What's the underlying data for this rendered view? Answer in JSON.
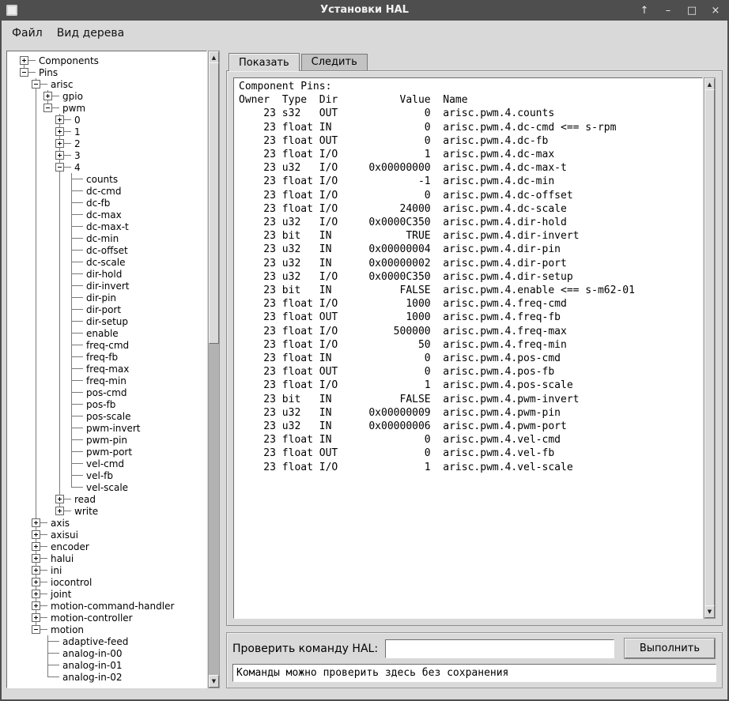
{
  "window": {
    "title": "Установки HAL",
    "controls": [
      {
        "name": "shade",
        "glyph": "↑"
      },
      {
        "name": "minimize",
        "glyph": "–"
      },
      {
        "name": "maximize",
        "glyph": "□"
      },
      {
        "name": "close",
        "glyph": "×"
      }
    ]
  },
  "menu": {
    "items": [
      {
        "label": "Файл"
      },
      {
        "label": "Вид дерева"
      }
    ]
  },
  "tabs": [
    {
      "label": "Показать",
      "active": true
    },
    {
      "label": "Следить",
      "active": false
    }
  ],
  "icons": {
    "scroll_up": "▲",
    "scroll_down": "▼"
  },
  "tree": {
    "nodes": [
      {
        "label": "Components",
        "state": "collapsed"
      },
      {
        "label": "Pins",
        "state": "expanded",
        "children": [
          {
            "label": "arisc",
            "state": "expanded",
            "children": [
              {
                "label": "gpio",
                "state": "collapsed"
              },
              {
                "label": "pwm",
                "state": "expanded",
                "children": [
                  {
                    "label": "0",
                    "state": "collapsed"
                  },
                  {
                    "label": "1",
                    "state": "collapsed"
                  },
                  {
                    "label": "2",
                    "state": "collapsed"
                  },
                  {
                    "label": "3",
                    "state": "collapsed"
                  },
                  {
                    "label": "4",
                    "state": "expanded",
                    "children": [
                      {
                        "label": "counts"
                      },
                      {
                        "label": "dc-cmd"
                      },
                      {
                        "label": "dc-fb"
                      },
                      {
                        "label": "dc-max"
                      },
                      {
                        "label": "dc-max-t"
                      },
                      {
                        "label": "dc-min"
                      },
                      {
                        "label": "dc-offset"
                      },
                      {
                        "label": "dc-scale"
                      },
                      {
                        "label": "dir-hold"
                      },
                      {
                        "label": "dir-invert"
                      },
                      {
                        "label": "dir-pin"
                      },
                      {
                        "label": "dir-port"
                      },
                      {
                        "label": "dir-setup"
                      },
                      {
                        "label": "enable"
                      },
                      {
                        "label": "freq-cmd"
                      },
                      {
                        "label": "freq-fb"
                      },
                      {
                        "label": "freq-max"
                      },
                      {
                        "label": "freq-min"
                      },
                      {
                        "label": "pos-cmd"
                      },
                      {
                        "label": "pos-fb"
                      },
                      {
                        "label": "pos-scale"
                      },
                      {
                        "label": "pwm-invert"
                      },
                      {
                        "label": "pwm-pin"
                      },
                      {
                        "label": "pwm-port"
                      },
                      {
                        "label": "vel-cmd"
                      },
                      {
                        "label": "vel-fb"
                      },
                      {
                        "label": "vel-scale"
                      }
                    ]
                  },
                  {
                    "label": "read",
                    "state": "collapsed"
                  },
                  {
                    "label": "write",
                    "state": "collapsed"
                  }
                ]
              }
            ]
          },
          {
            "label": "axis",
            "state": "collapsed"
          },
          {
            "label": "axisui",
            "state": "collapsed"
          },
          {
            "label": "encoder",
            "state": "collapsed"
          },
          {
            "label": "halui",
            "state": "collapsed"
          },
          {
            "label": "ini",
            "state": "collapsed"
          },
          {
            "label": "iocontrol",
            "state": "collapsed"
          },
          {
            "label": "joint",
            "state": "collapsed"
          },
          {
            "label": "motion-command-handler",
            "state": "collapsed"
          },
          {
            "label": "motion-controller",
            "state": "collapsed"
          },
          {
            "label": "motion",
            "state": "expanded",
            "children": [
              {
                "label": "adaptive-feed"
              },
              {
                "label": "analog-in-00"
              },
              {
                "label": "analog-in-01"
              },
              {
                "label": "analog-in-02"
              }
            ]
          }
        ]
      }
    ]
  },
  "pins": {
    "title": "Component Pins:",
    "headers": [
      "Owner",
      "Type",
      "Dir",
      "Value",
      "Name"
    ],
    "rows": [
      {
        "owner": "23",
        "type": "s32",
        "dir": "OUT",
        "value": "0",
        "name": "arisc.pwm.4.counts"
      },
      {
        "owner": "23",
        "type": "float",
        "dir": "IN",
        "value": "0",
        "name": "arisc.pwm.4.dc-cmd <== s-rpm"
      },
      {
        "owner": "23",
        "type": "float",
        "dir": "OUT",
        "value": "0",
        "name": "arisc.pwm.4.dc-fb"
      },
      {
        "owner": "23",
        "type": "float",
        "dir": "I/O",
        "value": "1",
        "name": "arisc.pwm.4.dc-max"
      },
      {
        "owner": "23",
        "type": "u32",
        "dir": "I/O",
        "value": "0x00000000",
        "name": "arisc.pwm.4.dc-max-t"
      },
      {
        "owner": "23",
        "type": "float",
        "dir": "I/O",
        "value": "-1",
        "name": "arisc.pwm.4.dc-min"
      },
      {
        "owner": "23",
        "type": "float",
        "dir": "I/O",
        "value": "0",
        "name": "arisc.pwm.4.dc-offset"
      },
      {
        "owner": "23",
        "type": "float",
        "dir": "I/O",
        "value": "24000",
        "name": "arisc.pwm.4.dc-scale"
      },
      {
        "owner": "23",
        "type": "u32",
        "dir": "I/O",
        "value": "0x0000C350",
        "name": "arisc.pwm.4.dir-hold"
      },
      {
        "owner": "23",
        "type": "bit",
        "dir": "IN",
        "value": "TRUE",
        "name": "arisc.pwm.4.dir-invert"
      },
      {
        "owner": "23",
        "type": "u32",
        "dir": "IN",
        "value": "0x00000004",
        "name": "arisc.pwm.4.dir-pin"
      },
      {
        "owner": "23",
        "type": "u32",
        "dir": "IN",
        "value": "0x00000002",
        "name": "arisc.pwm.4.dir-port"
      },
      {
        "owner": "23",
        "type": "u32",
        "dir": "I/O",
        "value": "0x0000C350",
        "name": "arisc.pwm.4.dir-setup"
      },
      {
        "owner": "23",
        "type": "bit",
        "dir": "IN",
        "value": "FALSE",
        "name": "arisc.pwm.4.enable <== s-m62-01"
      },
      {
        "owner": "23",
        "type": "float",
        "dir": "I/O",
        "value": "1000",
        "name": "arisc.pwm.4.freq-cmd"
      },
      {
        "owner": "23",
        "type": "float",
        "dir": "OUT",
        "value": "1000",
        "name": "arisc.pwm.4.freq-fb"
      },
      {
        "owner": "23",
        "type": "float",
        "dir": "I/O",
        "value": "500000",
        "name": "arisc.pwm.4.freq-max"
      },
      {
        "owner": "23",
        "type": "float",
        "dir": "I/O",
        "value": "50",
        "name": "arisc.pwm.4.freq-min"
      },
      {
        "owner": "23",
        "type": "float",
        "dir": "IN",
        "value": "0",
        "name": "arisc.pwm.4.pos-cmd"
      },
      {
        "owner": "23",
        "type": "float",
        "dir": "OUT",
        "value": "0",
        "name": "arisc.pwm.4.pos-fb"
      },
      {
        "owner": "23",
        "type": "float",
        "dir": "I/O",
        "value": "1",
        "name": "arisc.pwm.4.pos-scale"
      },
      {
        "owner": "23",
        "type": "bit",
        "dir": "IN",
        "value": "FALSE",
        "name": "arisc.pwm.4.pwm-invert"
      },
      {
        "owner": "23",
        "type": "u32",
        "dir": "IN",
        "value": "0x00000009",
        "name": "arisc.pwm.4.pwm-pin"
      },
      {
        "owner": "23",
        "type": "u32",
        "dir": "IN",
        "value": "0x00000006",
        "name": "arisc.pwm.4.pwm-port"
      },
      {
        "owner": "23",
        "type": "float",
        "dir": "IN",
        "value": "0",
        "name": "arisc.pwm.4.vel-cmd"
      },
      {
        "owner": "23",
        "type": "float",
        "dir": "OUT",
        "value": "0",
        "name": "arisc.pwm.4.vel-fb"
      },
      {
        "owner": "23",
        "type": "float",
        "dir": "I/O",
        "value": "1",
        "name": "arisc.pwm.4.vel-scale"
      }
    ]
  },
  "command": {
    "label": "Проверить команду HAL:",
    "input_value": "",
    "execute_label": "Выполнить",
    "hint": "Команды можно проверить здесь без сохранения"
  },
  "colors": {
    "window_bg": "#d9d9d9",
    "titlebar_bg": "#4e4e4e",
    "content_bg": "#ffffff"
  }
}
